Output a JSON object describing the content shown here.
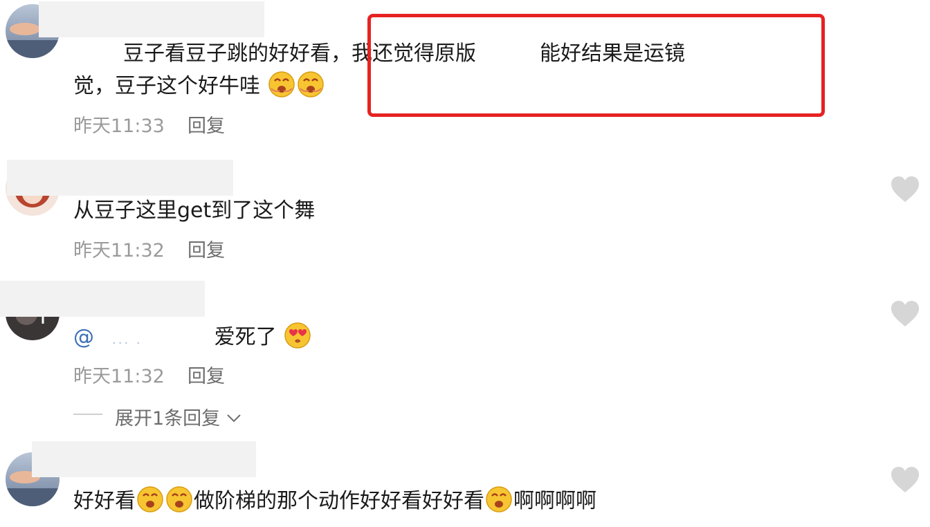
{
  "comments": [
    {
      "text_part1": "豆子看豆子跳的好好看，",
      "text_part2": "我还觉得原版",
      "text_part3": "能好结果是运镜",
      "text_line2": "觉，豆子这个好牛哇",
      "time": "昨天11:33",
      "reply": "回复",
      "emoji": "drooling-face-emoji"
    },
    {
      "text": "从豆子这里get到了这个舞",
      "time": "昨天11:32",
      "reply": "回复"
    },
    {
      "mention": "@",
      "mention_blur": "... .",
      "text": "爱死了",
      "time": "昨天11:32",
      "reply": "回复",
      "expand": "展开1条回复",
      "emoji": "heart-eyes-kiss-emoji"
    },
    {
      "text_a": "好好看",
      "text_b": "做阶梯的那个动作好好看好好看",
      "text_c": "啊啊啊啊",
      "emoji": "drooling-face-emoji"
    }
  ],
  "colors": {
    "highlight": "#e62222",
    "heart": "#d6d6d6",
    "mention": "#3b6fb6"
  }
}
